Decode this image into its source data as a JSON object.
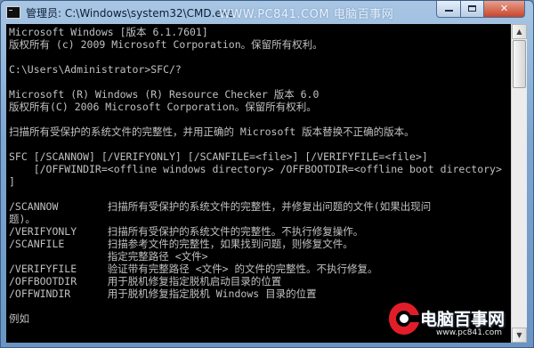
{
  "window": {
    "title": "管理员: C:\\Windows\\system32\\CMD.exe",
    "watermark": "WWW.PC841.COM 电脑百事网",
    "controls": {
      "minimize": "",
      "maximize": "",
      "close": "✕"
    }
  },
  "console": {
    "lines": [
      "Microsoft Windows [版本 6.1.7601]",
      "版权所有 (c) 2009 Microsoft Corporation。保留所有权利。",
      "",
      "C:\\Users\\Administrator>SFC/?",
      "",
      "Microsoft (R) Windows (R) Resource Checker 版本 6.0",
      "版权所有(C) 2006 Microsoft Corporation。保留所有权利。",
      "",
      "扫描所有受保护的系统文件的完整性，并用正确的 Microsoft 版本替换不正确的版本。",
      "",
      "SFC [/SCANNOW] [/VERIFYONLY] [/SCANFILE=<file>] [/VERIFYFILE=<file>]",
      "    [/OFFWINDIR=<offline windows directory> /OFFBOOTDIR=<offline boot directory>",
      "]",
      "",
      "/SCANNOW        扫描所有受保护的系统文件的完整性，并修复出问题的文件(如果出现问",
      "题)。",
      "/VERIFYONLY     扫描所有受保护的系统文件的完整性。不执行修复操作。",
      "/SCANFILE       扫描参考文件的完整性，如果找到问题，则修复文件。",
      "                指定完整路径 <文件>",
      "/VERIFYFILE     验证带有完整路径 <文件> 的文件的完整性。不执行修复。",
      "/OFFBOOTDIR     用于脱机修复指定脱机启动目录的位置",
      "/OFFWINDIR      用于脱机修复指定脱机 Windows 目录的位置",
      "",
      "例如"
    ]
  },
  "scrollbar": {
    "up_arrow": "▲",
    "down_arrow": "▼"
  },
  "logo": {
    "name": "电脑百事网",
    "url": "www.pc841.com"
  }
}
